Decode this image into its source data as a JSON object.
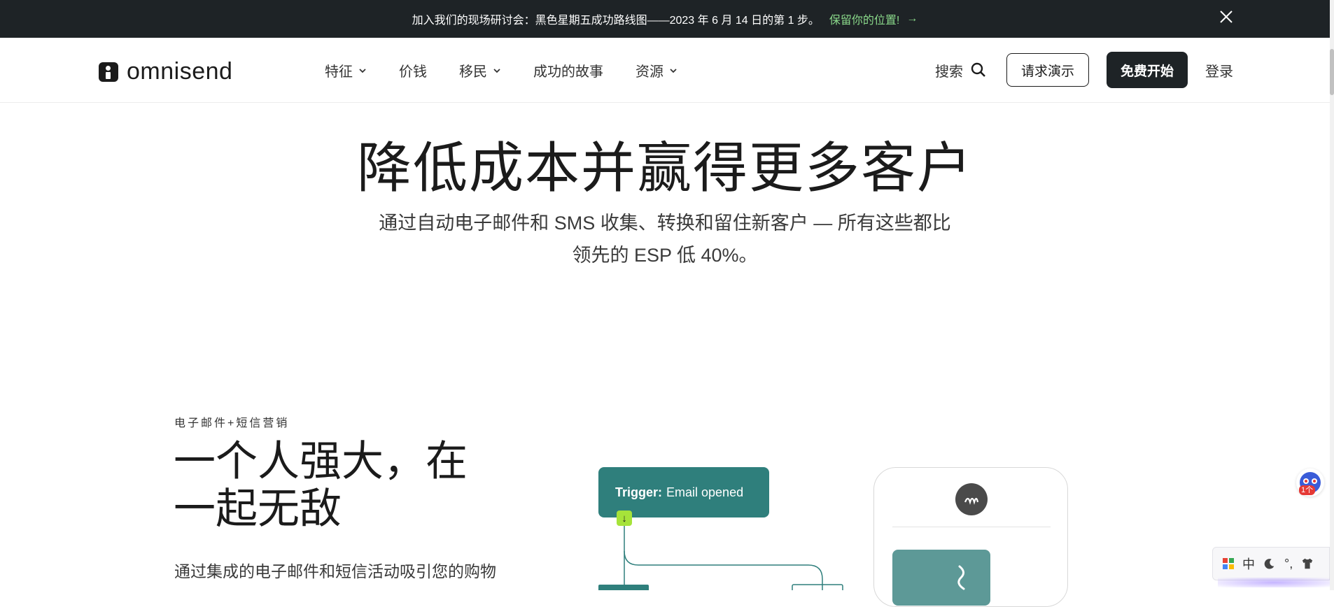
{
  "announcement": {
    "message": "加入我们的现场研讨会：黑色星期五成功路线图——2023 年 6 月 14 日的第 1 步。",
    "cta": "保留你的位置!",
    "arrow": "→"
  },
  "header": {
    "logo_text": "omnisend",
    "nav": [
      {
        "label": "特征",
        "dropdown": true
      },
      {
        "label": "价钱",
        "dropdown": false
      },
      {
        "label": "移民",
        "dropdown": true
      },
      {
        "label": "成功的故事",
        "dropdown": false
      },
      {
        "label": "资源",
        "dropdown": true
      }
    ],
    "search_label": "搜索",
    "demo_button": "请求演示",
    "start_button": "免费开始",
    "login": "登录"
  },
  "hero": {
    "title": "降低成本并赢得更多客户",
    "subtitle": "通过自动电子邮件和 SMS 收集、转换和留住新客户 — 所有这些都比领先的 ESP 低 40%。"
  },
  "section": {
    "eyebrow": "电子邮件+短信营销",
    "title": "一个人强大，在一起无敌",
    "body": "通过集成的电子邮件和短信活动吸引您的购物"
  },
  "illustration": {
    "trigger_label": "Trigger:",
    "trigger_value": "Email opened",
    "down_arrow": "↓"
  },
  "widgets": {
    "badge": "1个",
    "ime_label": "中",
    "ime_extra": "°,"
  },
  "colors": {
    "announcement_bg": "#1e2326",
    "cta_green": "#8ad88a",
    "teal": "#2f7f7c",
    "lime": "#a6e33a"
  }
}
